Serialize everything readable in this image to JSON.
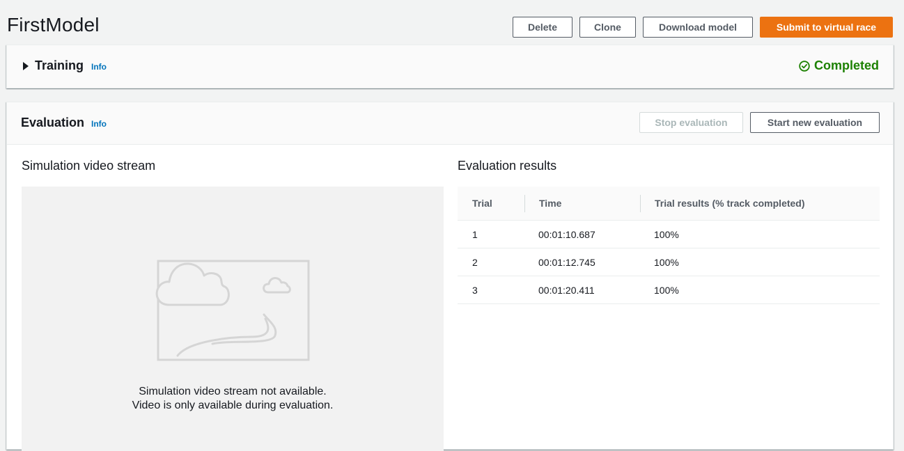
{
  "header": {
    "title": "FirstModel",
    "delete_label": "Delete",
    "clone_label": "Clone",
    "download_label": "Download model",
    "submit_label": "Submit to virtual race"
  },
  "training": {
    "title": "Training",
    "info": "Info",
    "status": "Completed",
    "status_icon": "check-circle-icon",
    "status_color": "#1d8102"
  },
  "evaluation": {
    "title": "Evaluation",
    "info": "Info",
    "stop_label": "Stop evaluation",
    "start_label": "Start new evaluation",
    "video": {
      "heading": "Simulation video stream",
      "placeholder_icon": "landscape-placeholder-icon",
      "message_line1": "Simulation video stream not available.",
      "message_line2": "Video is only available during evaluation."
    },
    "results": {
      "heading": "Evaluation results",
      "columns": [
        "Trial",
        "Time",
        "Trial results (% track completed)"
      ],
      "rows": [
        [
          "1",
          "00:01:10.687",
          "100%"
        ],
        [
          "2",
          "00:01:12.745",
          "100%"
        ],
        [
          "3",
          "00:01:20.411",
          "100%"
        ]
      ]
    }
  },
  "colors": {
    "accent": "#ec7211",
    "link": "#0073bb",
    "success": "#1d8102"
  }
}
